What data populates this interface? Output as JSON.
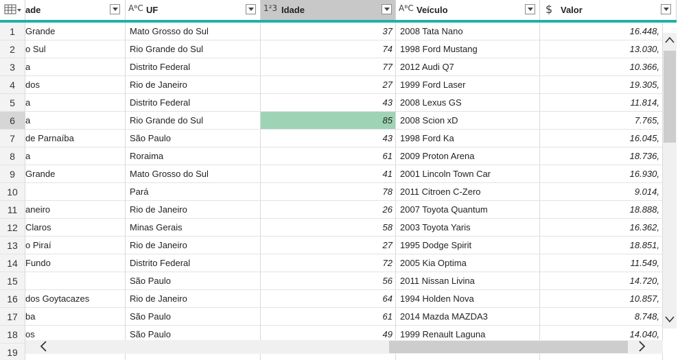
{
  "columns": [
    {
      "name": "ade",
      "icon": "",
      "type_icon_name": ""
    },
    {
      "name": "UF",
      "icon": "AᴮC",
      "type_icon_name": "text-type-icon"
    },
    {
      "name": "Idade",
      "icon": "1²3",
      "type_icon_name": "number-type-icon"
    },
    {
      "name": "Veículo",
      "icon": "AᴮC",
      "type_icon_name": "text-type-icon"
    },
    {
      "name": "Valor",
      "icon": "$",
      "type_icon_name": "currency-type-icon"
    }
  ],
  "accent_color": "#20b2a4",
  "highlight_color": "#9ed4b5",
  "selected_row": 6,
  "rows": [
    {
      "n": "1",
      "city": "Grande",
      "uf": "Mato Grosso do Sul",
      "idade": "37",
      "veiculo": "2008 Tata Nano",
      "valor": "16.448,"
    },
    {
      "n": "2",
      "city": "o Sul",
      "uf": "Rio Grande do Sul",
      "idade": "74",
      "veiculo": "1998 Ford Mustang",
      "valor": "13.030,"
    },
    {
      "n": "3",
      "city": "a",
      "uf": "Distrito Federal",
      "idade": "77",
      "veiculo": "2012 Audi Q7",
      "valor": "10.366,"
    },
    {
      "n": "4",
      "city": "dos",
      "uf": "Rio de Janeiro",
      "idade": "27",
      "veiculo": "1999 Ford Laser",
      "valor": "19.305,"
    },
    {
      "n": "5",
      "city": "a",
      "uf": "Distrito Federal",
      "idade": "43",
      "veiculo": "2008 Lexus GS",
      "valor": "11.814,"
    },
    {
      "n": "6",
      "city": "a",
      "uf": "Rio Grande do Sul",
      "idade": "85",
      "veiculo": "2008 Scion xD",
      "valor": "7.765,"
    },
    {
      "n": "7",
      "city": "de Parnaíba",
      "uf": "São Paulo",
      "idade": "43",
      "veiculo": "1998 Ford Ka",
      "valor": "16.045,"
    },
    {
      "n": "8",
      "city": "a",
      "uf": "Roraima",
      "idade": "61",
      "veiculo": "2009 Proton Arena",
      "valor": "18.736,"
    },
    {
      "n": "9",
      "city": "Grande",
      "uf": "Mato Grosso do Sul",
      "idade": "41",
      "veiculo": "2001 Lincoln Town Car",
      "valor": "16.930,"
    },
    {
      "n": "10",
      "city": "",
      "uf": "Pará",
      "idade": "78",
      "veiculo": "2011 Citroen C-Zero",
      "valor": "9.014,"
    },
    {
      "n": "11",
      "city": "aneiro",
      "uf": "Rio de Janeiro",
      "idade": "26",
      "veiculo": "2007 Toyota Quantum",
      "valor": "18.888,"
    },
    {
      "n": "12",
      "city": "Claros",
      "uf": "Minas Gerais",
      "idade": "58",
      "veiculo": "2003 Toyota Yaris",
      "valor": "16.362,"
    },
    {
      "n": "13",
      "city": "o Piraí",
      "uf": "Rio de Janeiro",
      "idade": "27",
      "veiculo": "1995 Dodge Spirit",
      "valor": "18.851,"
    },
    {
      "n": "14",
      "city": "Fundo",
      "uf": "Distrito Federal",
      "idade": "72",
      "veiculo": "2005 Kia Optima",
      "valor": "11.549,"
    },
    {
      "n": "15",
      "city": "",
      "uf": "São Paulo",
      "idade": "56",
      "veiculo": "2011 Nissan Livina",
      "valor": "14.720,"
    },
    {
      "n": "16",
      "city": "dos Goytacazes",
      "uf": "Rio de Janeiro",
      "idade": "64",
      "veiculo": "1994 Holden Nova",
      "valor": "10.857,"
    },
    {
      "n": "17",
      "city": "ba",
      "uf": "São Paulo",
      "idade": "61",
      "veiculo": "2014 Mazda MAZDA3",
      "valor": "8.748,"
    },
    {
      "n": "18",
      "city": "os",
      "uf": "São Paulo",
      "idade": "49",
      "veiculo": "1999 Renault Laguna",
      "valor": "14.040,"
    },
    {
      "n": "19",
      "city": "",
      "uf": "",
      "idade": "",
      "veiculo": "",
      "valor": ""
    }
  ],
  "scroll": {
    "up_icon": "^",
    "down_icon": "v",
    "left_icon": "<",
    "right_icon": ">"
  }
}
